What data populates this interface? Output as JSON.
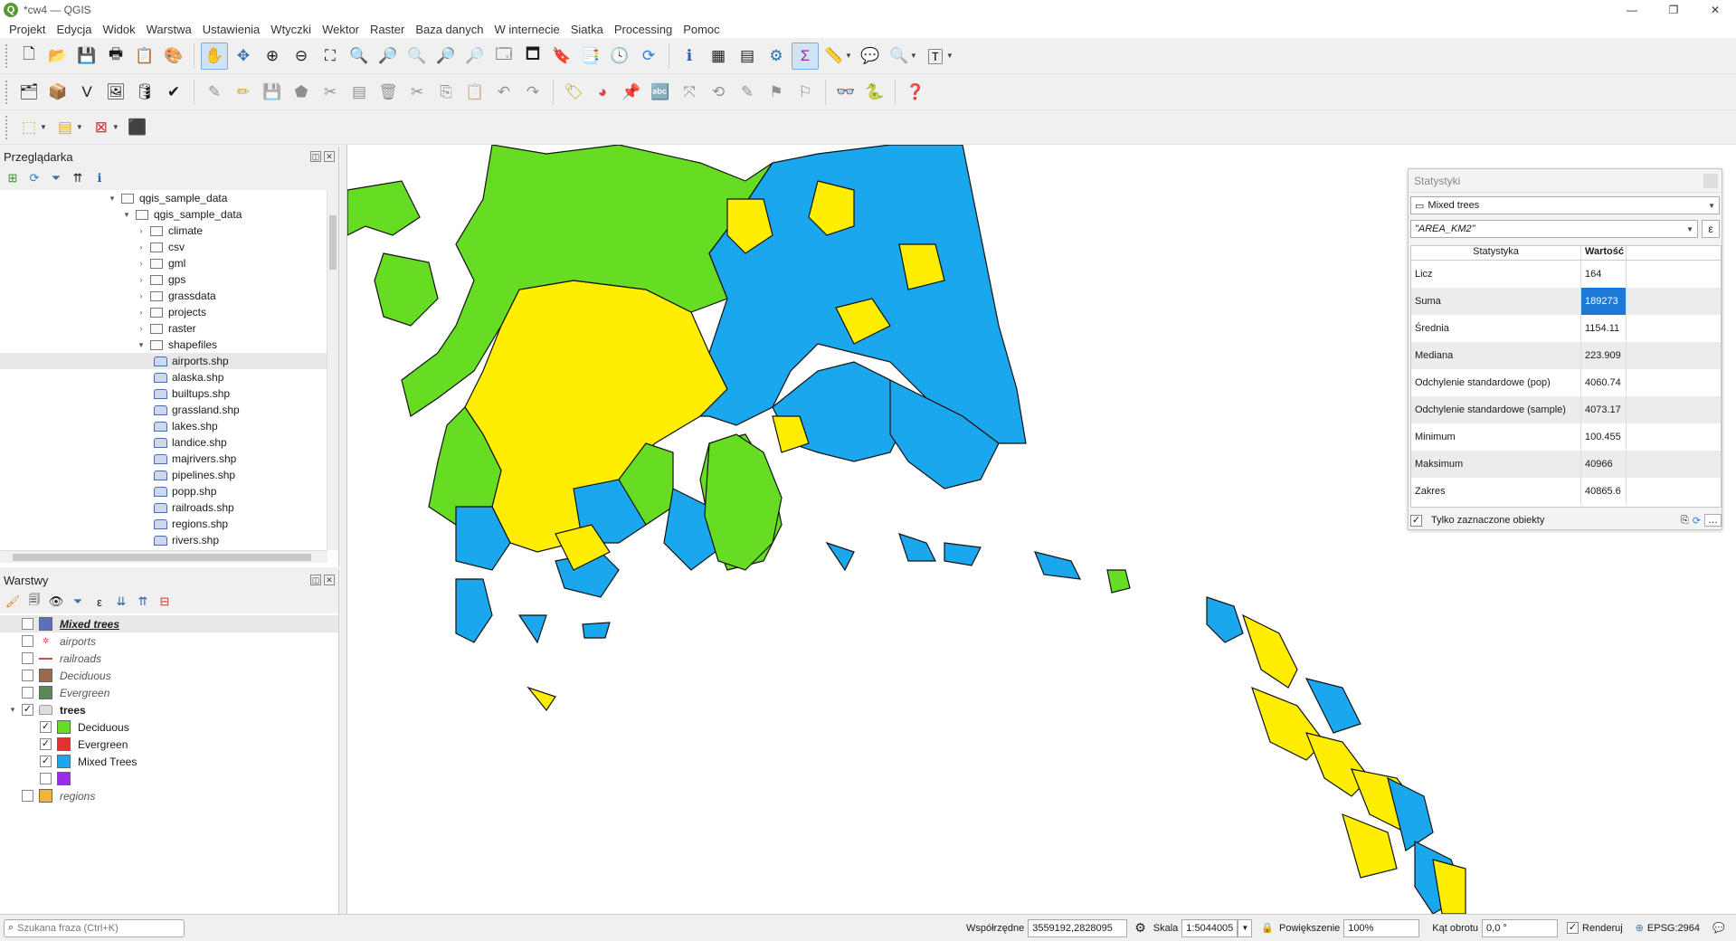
{
  "window": {
    "title": "*cw4 — QGIS",
    "logo_letter": "Q",
    "minimize": "—",
    "restore": "❐",
    "close": "✕"
  },
  "menu": [
    "Projekt",
    "Edycja",
    "Widok",
    "Warstwa",
    "Ustawienia",
    "Wtyczki",
    "Wektor",
    "Raster",
    "Baza danych",
    "W internecie",
    "Siatka",
    "Processing",
    "Pomoc"
  ],
  "browser": {
    "title": "Przeglądarka",
    "items": [
      {
        "label": "qgis_sample_data",
        "indent": 1,
        "arrow": "▾"
      },
      {
        "label": "qgis_sample_data",
        "indent": 2,
        "arrow": "▾"
      },
      {
        "label": "climate",
        "indent": 3,
        "arrow": "›"
      },
      {
        "label": "csv",
        "indent": 3,
        "arrow": "›"
      },
      {
        "label": "gml",
        "indent": 3,
        "arrow": "›"
      },
      {
        "label": "gps",
        "indent": 3,
        "arrow": "›"
      },
      {
        "label": "grassdata",
        "indent": 3,
        "arrow": "›"
      },
      {
        "label": "projects",
        "indent": 3,
        "arrow": "›"
      },
      {
        "label": "raster",
        "indent": 3,
        "arrow": "›"
      },
      {
        "label": "shapefiles",
        "indent": 3,
        "arrow": "▾"
      },
      {
        "label": "airports.shp",
        "indent": 4,
        "shp": true,
        "selected": true
      },
      {
        "label": "alaska.shp",
        "indent": 4,
        "shp": true
      },
      {
        "label": "builtups.shp",
        "indent": 4,
        "shp": true
      },
      {
        "label": "grassland.shp",
        "indent": 4,
        "shp": true
      },
      {
        "label": "lakes.shp",
        "indent": 4,
        "shp": true
      },
      {
        "label": "landice.shp",
        "indent": 4,
        "shp": true
      },
      {
        "label": "majrivers.shp",
        "indent": 4,
        "shp": true
      },
      {
        "label": "pipelines.shp",
        "indent": 4,
        "shp": true
      },
      {
        "label": "popp.shp",
        "indent": 4,
        "shp": true
      },
      {
        "label": "railroads.shp",
        "indent": 4,
        "shp": true
      },
      {
        "label": "regions.shp",
        "indent": 4,
        "shp": true
      },
      {
        "label": "rivers.shp",
        "indent": 4,
        "shp": true
      }
    ]
  },
  "layers": {
    "title": "Warstwy",
    "items": [
      {
        "label": "Mixed trees",
        "style": "bi",
        "checked": false,
        "color": "#5b6fbf",
        "kind": "swatch",
        "level": 0,
        "selected": true
      },
      {
        "label": "airports",
        "style": "i",
        "checked": false,
        "color": "#d05050",
        "kind": "point",
        "level": 0
      },
      {
        "label": "railroads",
        "style": "i",
        "checked": false,
        "color": "#c05050",
        "kind": "line",
        "level": 0
      },
      {
        "label": "Deciduous",
        "style": "i",
        "checked": false,
        "color": "#9c6a4e",
        "kind": "swatch",
        "level": 0
      },
      {
        "label": "Evergreen",
        "style": "i",
        "checked": false,
        "color": "#5a8a5a",
        "kind": "swatch",
        "level": 0
      },
      {
        "label": "trees",
        "style": "b",
        "checked": true,
        "color": "#dddddd",
        "kind": "group",
        "level": 0
      },
      {
        "label": "Deciduous",
        "style": "n",
        "checked": true,
        "color": "#66dd22",
        "kind": "swatch",
        "level": 1
      },
      {
        "label": "Evergreen",
        "style": "n",
        "checked": true,
        "color": "#e33030",
        "kind": "swatch",
        "level": 1
      },
      {
        "label": "Mixed Trees",
        "style": "n",
        "checked": true,
        "color": "#1aa7ee",
        "kind": "swatch",
        "level": 1
      },
      {
        "label": "",
        "style": "n",
        "checked": false,
        "color": "#9a2ee6",
        "kind": "swatch",
        "level": 1
      },
      {
        "label": "regions",
        "style": "i",
        "checked": false,
        "color": "#f0b43a",
        "kind": "swatch",
        "level": 0
      }
    ]
  },
  "stats": {
    "title": "Statystyki",
    "layer": "Mixed trees",
    "field": "\"AREA_KM2\"",
    "col_stat": "Statystyka",
    "col_value": "Wartość",
    "rows": [
      {
        "name": "Licz",
        "value": "164"
      },
      {
        "name": "Suma",
        "value": "189273",
        "highlight": true
      },
      {
        "name": "Średnia",
        "value": "1154.11"
      },
      {
        "name": "Mediana",
        "value": "223.909"
      },
      {
        "name": "Odchylenie standardowe (pop)",
        "value": "4060.74"
      },
      {
        "name": "Odchylenie standardowe (sample)",
        "value": "4073.17"
      },
      {
        "name": "Minimum",
        "value": "100.455"
      },
      {
        "name": "Maksimum",
        "value": "40966"
      },
      {
        "name": "Zakres",
        "value": "40865.6"
      }
    ],
    "only_selected": "Tylko zaznaczone obiekty"
  },
  "map_colors": {
    "deciduous": "#66dd22",
    "mixed": "#1aa7ee",
    "evergreen": "#ffee00"
  },
  "statusbar": {
    "search_placeholder": "Szukana fraza (Ctrl+K)",
    "coord_label": "Współrzędne",
    "coord_value": "3559192,2828095",
    "scale_label": "Skala",
    "scale_value": "1:5044005",
    "zoom_label": "Powiększenie",
    "zoom_value": "100%",
    "rotation_label": "Kąt obrotu",
    "rotation_value": "0,0 °",
    "render_label": "Renderuj",
    "crs": "EPSG:2964"
  }
}
